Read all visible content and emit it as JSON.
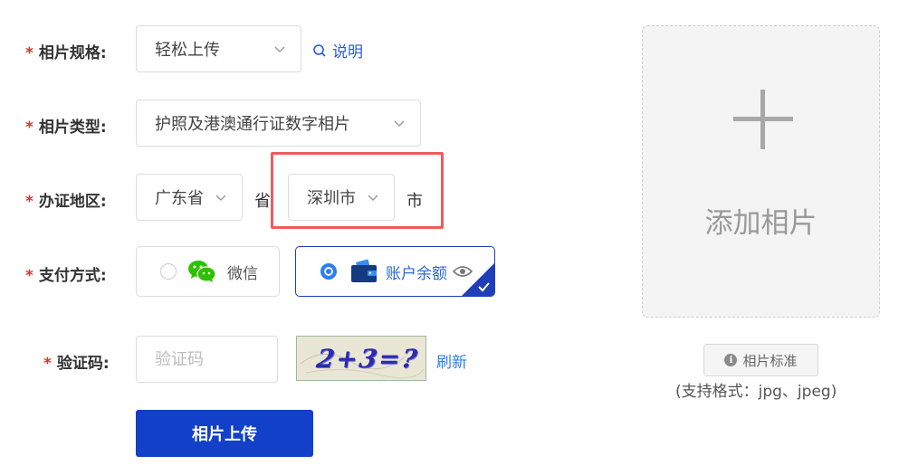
{
  "form": {
    "required_mark": "*",
    "spec": {
      "label": "相片规格:",
      "value": "轻松上传",
      "help_link": "说明"
    },
    "type": {
      "label": "相片类型:",
      "value": "护照及港澳通行证数字相片"
    },
    "region": {
      "label": "办证地区:",
      "province": "广东省",
      "province_unit": "省",
      "city": "深圳市",
      "city_unit": "市"
    },
    "payment": {
      "label": "支付方式:",
      "options": [
        {
          "label": "微信",
          "icon": "wechat-icon",
          "selected": false
        },
        {
          "label": "账户余额",
          "icon": "wallet-icon",
          "selected": true
        }
      ]
    },
    "captcha": {
      "label": "验证码:",
      "placeholder": "验证码",
      "image_text": "2+3=?",
      "refresh": "刷新"
    },
    "submit": "相片上传"
  },
  "upload": {
    "add_text": "添加相片",
    "standard_button": "相片标准",
    "formats": "(支持格式：jpg、jpeg)"
  },
  "colors": {
    "primary": "#1240c8",
    "required": "#e0312b",
    "link": "#2a5bd7",
    "highlight": "#ee5b5b",
    "wechat": "#2dc100"
  }
}
